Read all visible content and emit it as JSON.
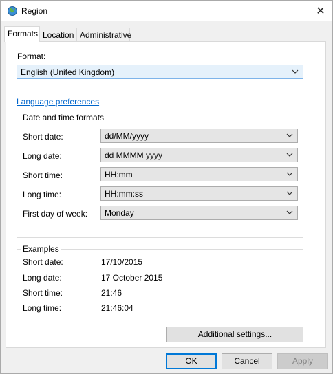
{
  "window": {
    "title": "Region",
    "close_glyph": "✕"
  },
  "tabs": [
    {
      "label": "Formats"
    },
    {
      "label": "Location"
    },
    {
      "label": "Administrative"
    }
  ],
  "format": {
    "label": "Format:",
    "value": "English (United Kingdom)"
  },
  "language_link": "Language preferences",
  "date_time": {
    "title": "Date and time formats",
    "short_date": {
      "label": "Short date:",
      "value": "dd/MM/yyyy"
    },
    "long_date": {
      "label": "Long date:",
      "value": "dd MMMM yyyy"
    },
    "short_time": {
      "label": "Short time:",
      "value": "HH:mm"
    },
    "long_time": {
      "label": "Long time:",
      "value": "HH:mm:ss"
    },
    "first_day": {
      "label": "First day of week:",
      "value": "Monday"
    }
  },
  "examples": {
    "title": "Examples",
    "short_date": {
      "label": "Short date:",
      "value": "17/10/2015"
    },
    "long_date": {
      "label": "Long date:",
      "value": "17 October 2015"
    },
    "short_time": {
      "label": "Short time:",
      "value": "21:46"
    },
    "long_time": {
      "label": "Long time:",
      "value": "21:46:04"
    }
  },
  "buttons": {
    "additional": "Additional settings...",
    "ok": "OK",
    "cancel": "Cancel",
    "apply": "Apply"
  }
}
